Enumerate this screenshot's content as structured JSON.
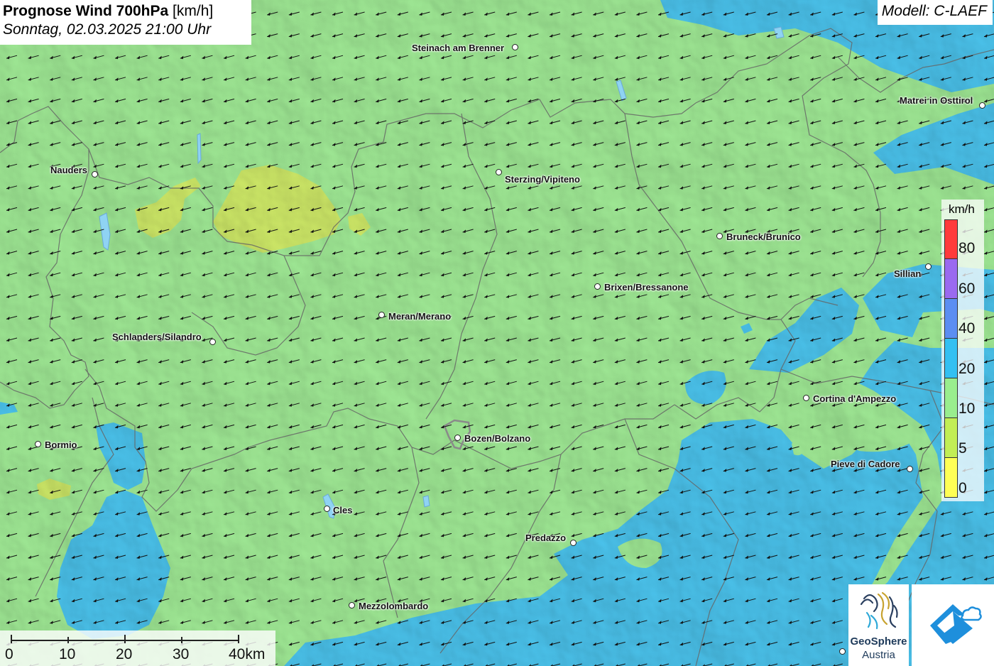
{
  "title": {
    "prefix": "Prognose Wind 700hPa",
    "unit": "[km/h]",
    "datetime": "Sonntag, 02.03.2025 21:00 Uhr"
  },
  "model": "Modell: C-LAEF",
  "cities": [
    {
      "name": "Steinach am Brenner"
    },
    {
      "name": "Matrei in Osttirol"
    },
    {
      "name": "Nauders"
    },
    {
      "name": "Sterzing/Vipiteno"
    },
    {
      "name": "Bruneck/Brunico"
    },
    {
      "name": "Sillian"
    },
    {
      "name": "Brixen/Bressanone"
    },
    {
      "name": "Meran/Merano"
    },
    {
      "name": "Schlanders/Silandro"
    },
    {
      "name": "Cortina d'Ampezzo"
    },
    {
      "name": "Bozen/Bolzano"
    },
    {
      "name": "Bormio"
    },
    {
      "name": "Pieve di Cadore"
    },
    {
      "name": "Cles"
    },
    {
      "name": "Predazzo"
    },
    {
      "name": "Mezzolombardo"
    }
  ],
  "legend": {
    "unit": "km/h",
    "colors": [
      "#ff3b3b",
      "#9a6af0",
      "#5b8ef2",
      "#33c0f2",
      "#99ee8e",
      "#c2ee55",
      "#ffff55"
    ],
    "labels": [
      "80",
      "60",
      "40",
      "20",
      "10",
      "5",
      "0"
    ]
  },
  "scale_bar": {
    "labels": [
      "0",
      "10",
      "20",
      "30",
      "40km"
    ]
  },
  "logos": {
    "geosphere_line1": "GeoSphere",
    "geosphere_line2": "Austria"
  },
  "wind": {
    "arrow_icon": "wind-arrow-icon",
    "dominant_direction": "from east-northeast"
  }
}
